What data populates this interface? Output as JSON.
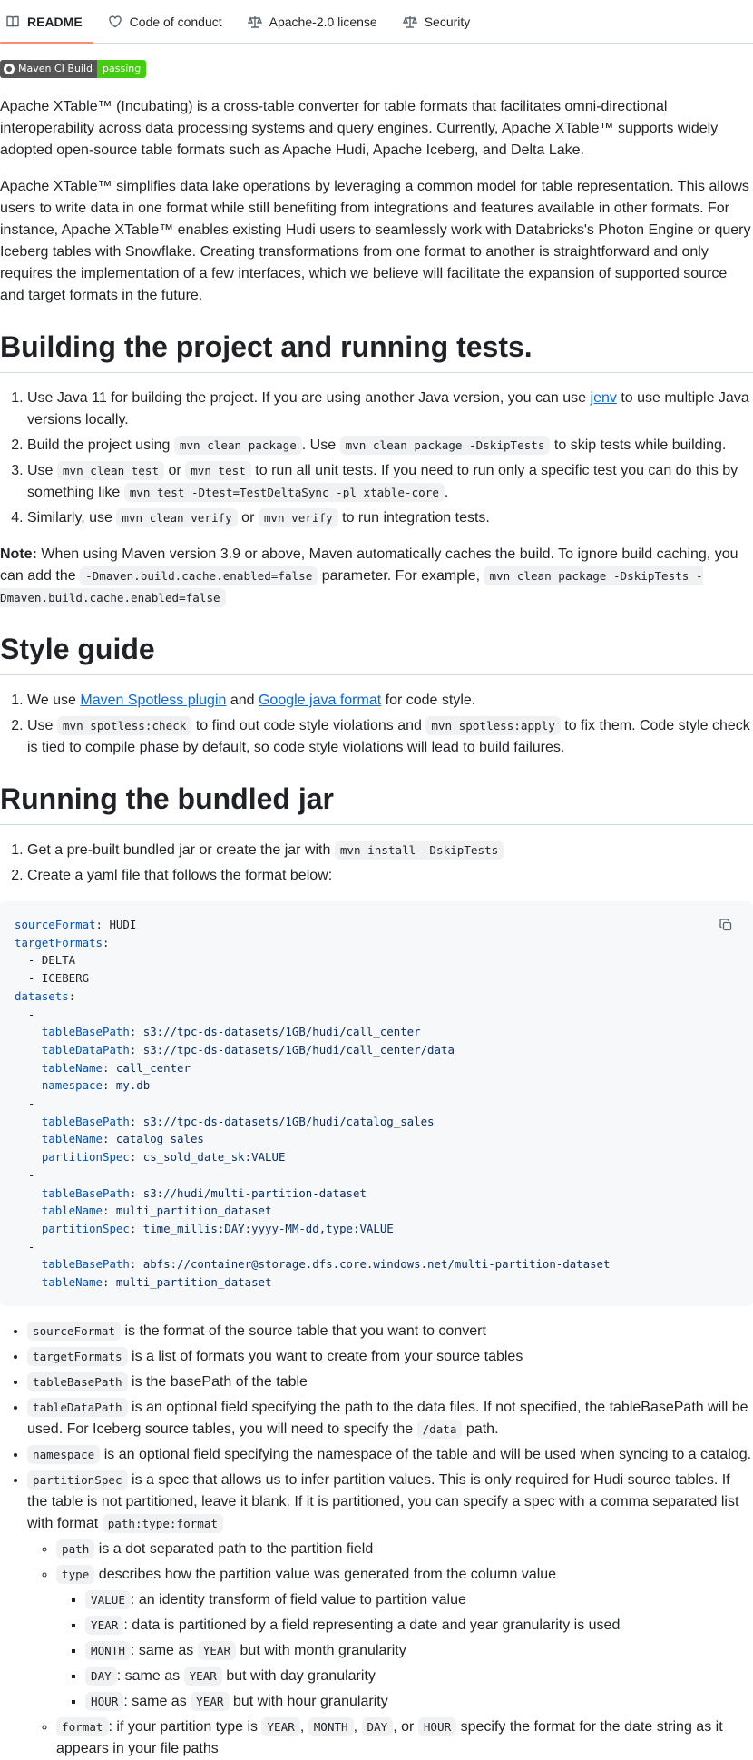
{
  "tabs": [
    {
      "label": "README",
      "icon": "book-icon"
    },
    {
      "label": "Code of conduct",
      "icon": "heart-icon"
    },
    {
      "label": "Apache-2.0 license",
      "icon": "scale-icon"
    },
    {
      "label": "Security",
      "icon": "scale-icon"
    }
  ],
  "badge": {
    "left": "Maven CI Build",
    "right": "passing",
    "right_color": "#44cc11"
  },
  "intro": [
    "Apache XTable™ (Incubating) is a cross-table converter for table formats that facilitates omni-directional interoperability across data processing systems and query engines. Currently, Apache XTable™ supports widely adopted open-source table formats such as Apache Hudi, Apache Iceberg, and Delta Lake.",
    "Apache XTable™ simplifies data lake operations by leveraging a common model for table representation. This allows users to write data in one format while still benefiting from integrations and features available in other formats. For instance, Apache XTable™ enables existing Hudi users to seamlessly work with Databricks's Photon Engine or query Iceberg tables with Snowflake. Creating transformations from one format to another is straightforward and only requires the implementation of a few interfaces, which we believe will facilitate the expansion of supported source and target formats in the future."
  ],
  "build": {
    "heading": "Building the project and running tests.",
    "s1_a": "Use Java 11 for building the project. If you are using another Java version, you can use ",
    "s1_link": "jenv",
    "s1_b": " to use multiple Java versions locally.",
    "s2_a": "Build the project using ",
    "s2_c1": "mvn clean package",
    "s2_b": ". Use ",
    "s2_c2": "mvn clean package -DskipTests",
    "s2_d": " to skip tests while building.",
    "s3_a": "Use ",
    "s3_c1": "mvn clean test",
    "s3_b": " or ",
    "s3_c2": "mvn test",
    "s3_d": " to run all unit tests. If you need to run only a specific test you can do this by something like ",
    "s3_c3": "mvn test -Dtest=TestDeltaSync -pl xtable-core",
    "s3_e": ".",
    "s4_a": "Similarly, use ",
    "s4_c1": "mvn clean verify",
    "s4_b": " or ",
    "s4_c2": "mvn verify",
    "s4_d": " to run integration tests.",
    "note_label": "Note:",
    "note_a": " When using Maven version 3.9 or above, Maven automatically caches the build. To ignore build caching, you can add the ",
    "note_c1": "-Dmaven.build.cache.enabled=false",
    "note_b": " parameter. For example, ",
    "note_c2": "mvn clean package -DskipTests -Dmaven.build.cache.enabled=false"
  },
  "style": {
    "heading": "Style guide",
    "s1_a": "We use ",
    "s1_link1": "Maven Spotless plugin",
    "s1_b": " and ",
    "s1_link2": "Google java format",
    "s1_c": " for code style.",
    "s2_a": "Use ",
    "s2_c1": "mvn spotless:check",
    "s2_b": " to find out code style violations and ",
    "s2_c2": "mvn spotless:apply",
    "s2_c": " to fix them. Code style check is tied to compile phase by default, so code style violations will lead to build failures."
  },
  "jar": {
    "heading": "Running the bundled jar",
    "s1_a": "Get a pre-built bundled jar or create the jar with ",
    "s1_c1": "mvn install -DskipTests",
    "s2": "Create a yaml file that follows the format below:"
  },
  "yaml": {
    "sourceFormat_k": "sourceFormat",
    "sourceFormat_v": "HUDI",
    "targetFormats_k": "targetFormats",
    "t1": "DELTA",
    "t2": "ICEBERG",
    "datasets_k": "datasets",
    "d1_tbp": "s3://tpc-ds-datasets/1GB/hudi/call_center",
    "d1_tdp": "s3://tpc-ds-datasets/1GB/hudi/call_center/data",
    "d1_tn": "call_center",
    "d1_ns": "my.db",
    "d2_tbp": "s3://tpc-ds-datasets/1GB/hudi/catalog_sales",
    "d2_tn": "catalog_sales",
    "d2_ps": "cs_sold_date_sk:VALUE",
    "d3_tbp": "s3://hudi/multi-partition-dataset",
    "d3_tn": "multi_partition_dataset",
    "d3_ps": "time_millis:DAY:yyyy-MM-dd,type:VALUE",
    "d4_tbp": "abfs://container@storage.dfs.core.windows.net/multi-partition-dataset",
    "d4_tn": "multi_partition_dataset",
    "key_tbp": "tableBasePath",
    "key_tdp": "tableDataPath",
    "key_tn": "tableName",
    "key_ns": "namespace",
    "key_ps": "partitionSpec"
  },
  "fields": {
    "f1_c": "sourceFormat",
    "f1_t": " is the format of the source table that you want to convert",
    "f2_c": "targetFormats",
    "f2_t": " is a list of formats you want to create from your source tables",
    "f3_c": "tableBasePath",
    "f3_t": " is the basePath of the table",
    "f4_c": "tableDataPath",
    "f4_t": " is an optional field specifying the path to the data files. If not specified, the tableBasePath will be used. For Iceberg source tables, you will need to specify the ",
    "f4_c2": "/data",
    "f4_t2": " path.",
    "f5_c": "namespace",
    "f5_t": " is an optional field specifying the namespace of the table and will be used when syncing to a catalog.",
    "f6_c": "partitionSpec",
    "f6_t": " is a spec that allows us to infer partition values. This is only required for Hudi source tables. If the table is not partitioned, leave it blank. If it is partitioned, you can specify a spec with a comma separated list with format ",
    "f6_c2": "path:type:format",
    "p_c": "path",
    "p_t": " is a dot separated path to the partition field",
    "ty_c": "type",
    "ty_t": " describes how the partition value was generated from the column value",
    "v_c": "VALUE",
    "v_t": ": an identity transform of field value to partition value",
    "y_c": "YEAR",
    "y_t": ": data is partitioned by a field representing a date and year granularity is used",
    "m_c": "MONTH",
    "m_t": ": same as ",
    "m_c2": "YEAR",
    "m_t2": " but with month granularity",
    "d_c": "DAY",
    "d_t": ": same as ",
    "d_c2": "YEAR",
    "d_t2": " but with day granularity",
    "h_c": "HOUR",
    "h_t": ": same as ",
    "h_c2": "YEAR",
    "h_t2": " but with hour granularity",
    "fo_c": "format",
    "fo_t": ": if your partition type is ",
    "fo_c2": "YEAR",
    "fo_s1": ", ",
    "fo_c3": "MONTH",
    "fo_s2": ", ",
    "fo_c4": "DAY",
    "fo_s3": ", or ",
    "fo_c5": "HOUR",
    "fo_t2": " specify the format for the date string as it appears in your file paths"
  }
}
